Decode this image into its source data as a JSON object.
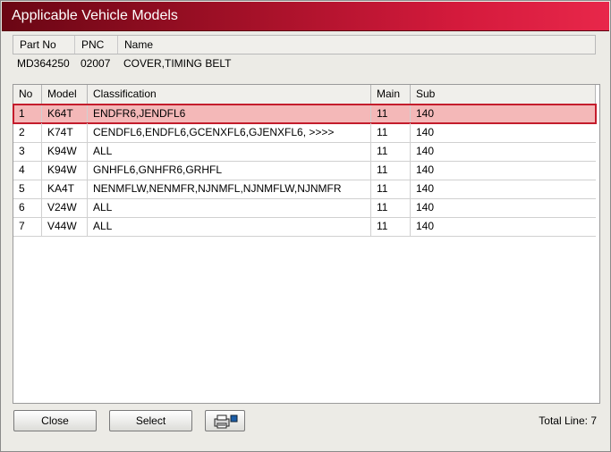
{
  "window": {
    "title": "Applicable Vehicle Models"
  },
  "part": {
    "headers": {
      "part_no": "Part No",
      "pnc": "PNC",
      "name": "Name"
    },
    "values": {
      "part_no": "MD364250",
      "pnc": "02007",
      "name": "COVER,TIMING BELT"
    }
  },
  "table": {
    "columns": {
      "no": "No",
      "model": "Model",
      "classification": "Classification",
      "main": "Main",
      "sub": "Sub"
    },
    "rows": [
      {
        "no": "1",
        "model": "K64T",
        "classification": "ENDFR6,JENDFL6",
        "main": "11",
        "sub": "140"
      },
      {
        "no": "2",
        "model": "K74T",
        "classification": "CENDFL6,ENDFL6,GCENXFL6,GJENXFL6,  >>>>",
        "main": "11",
        "sub": "140"
      },
      {
        "no": "3",
        "model": "K94W",
        "classification": "ALL",
        "main": "11",
        "sub": "140"
      },
      {
        "no": "4",
        "model": "K94W",
        "classification": "GNHFL6,GNHFR6,GRHFL",
        "main": "11",
        "sub": "140"
      },
      {
        "no": "5",
        "model": "KA4T",
        "classification": "NENMFLW,NENMFR,NJNMFL,NJNMFLW,NJNMFR",
        "main": "11",
        "sub": "140"
      },
      {
        "no": "6",
        "model": "V24W",
        "classification": "ALL",
        "main": "11",
        "sub": "140"
      },
      {
        "no": "7",
        "model": "V44W",
        "classification": "ALL",
        "main": "11",
        "sub": "140"
      }
    ],
    "selected_index": 0
  },
  "footer": {
    "close_label": "Close",
    "select_label": "Select",
    "print_icon": "printer-icon",
    "total_line": "Total Line: 7"
  },
  "colors": {
    "title_gradient_start": "#6a0614",
    "title_gradient_end": "#e8274a",
    "selected_row_bg": "#f4b8b8",
    "selected_row_border": "#c41c2c"
  }
}
